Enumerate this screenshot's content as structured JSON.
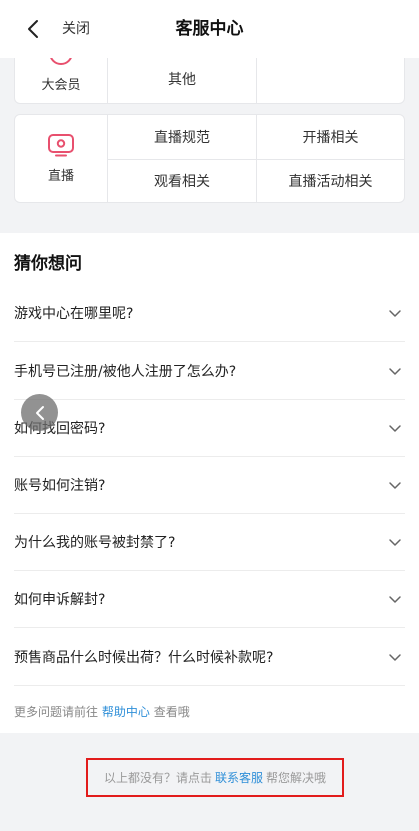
{
  "header": {
    "close_label": "关闭",
    "title": "客服中心"
  },
  "categories": [
    {
      "name": "大会员",
      "icon": "vip-icon",
      "items": [
        "其他"
      ]
    },
    {
      "name": "直播",
      "icon": "live-tv-icon",
      "items": [
        "直播规范",
        "开播相关",
        "观看相关",
        "直播活动相关"
      ]
    }
  ],
  "guess": {
    "title": "猜你想问",
    "questions": [
      "游戏中心在哪里呢?",
      "手机号已注册/被他人注册了怎么办?",
      "如何找回密码?",
      "账号如何注销?",
      "为什么我的账号被封禁了?",
      "如何申诉解封?",
      "预售商品什么时候出荷？什么时候补款呢?"
    ],
    "more_prefix": "更多问题请前往",
    "more_link": "帮助中心",
    "more_suffix": "查看哦"
  },
  "footer": {
    "prefix": "以上都没有？请点击",
    "link": "联系客服",
    "suffix": "帮您解决哦"
  },
  "colors": {
    "accent": "#2f8fd8",
    "icon_pink": "#e8506e",
    "highlight_border": "#e21b1b"
  }
}
